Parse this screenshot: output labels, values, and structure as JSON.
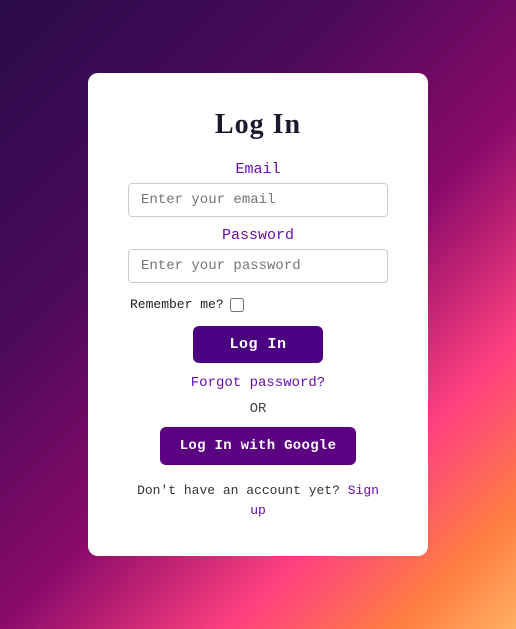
{
  "page": {
    "title": "Log In",
    "email": {
      "label": "Email",
      "placeholder": "Enter your email"
    },
    "password": {
      "label": "Password",
      "placeholder": "Enter your password"
    },
    "remember": {
      "label": "Remember me?"
    },
    "login_button": "Log In",
    "forgot_password": "Forgot password?",
    "or_divider": "OR",
    "google_button": "Log In with Google",
    "signup_text": "Don't have an account yet?",
    "signup_link": "Sign up"
  }
}
